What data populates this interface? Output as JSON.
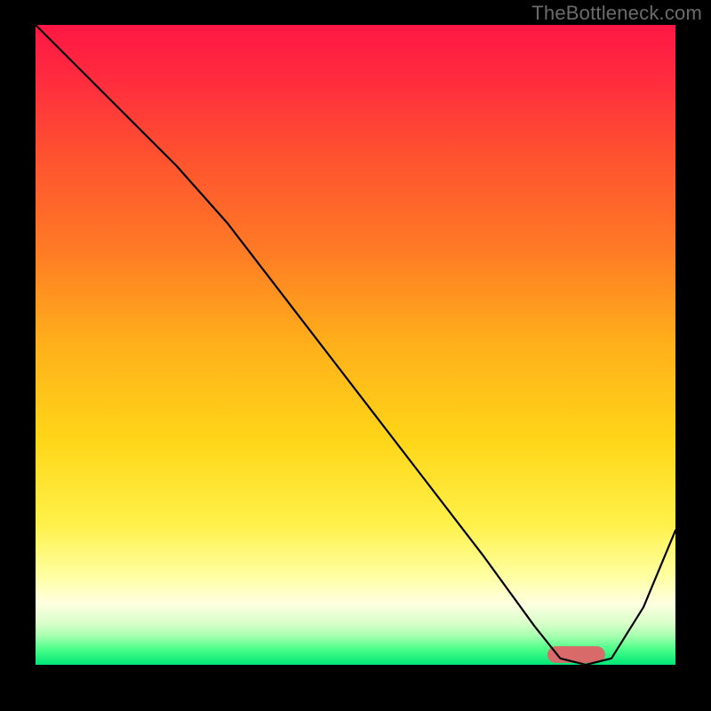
{
  "watermark": "TheBottleneck.com",
  "chart_data": {
    "type": "line",
    "title": "",
    "xlabel": "",
    "ylabel": "",
    "xlim": [
      0,
      100
    ],
    "ylim": [
      0,
      100
    ],
    "grid": false,
    "legend": false,
    "gradient_stops": [
      {
        "offset": 0.0,
        "color": "#ff1744"
      },
      {
        "offset": 0.08,
        "color": "#ff2a3f"
      },
      {
        "offset": 0.2,
        "color": "#ff5030"
      },
      {
        "offset": 0.35,
        "color": "#ff7a25"
      },
      {
        "offset": 0.5,
        "color": "#ffb01a"
      },
      {
        "offset": 0.65,
        "color": "#ffd618"
      },
      {
        "offset": 0.78,
        "color": "#fff14a"
      },
      {
        "offset": 0.86,
        "color": "#ffffa0"
      },
      {
        "offset": 0.905,
        "color": "#fdffe0"
      },
      {
        "offset": 0.935,
        "color": "#d9ffca"
      },
      {
        "offset": 0.955,
        "color": "#a6ffae"
      },
      {
        "offset": 0.975,
        "color": "#4eff8a"
      },
      {
        "offset": 1.0,
        "color": "#00e676"
      }
    ],
    "series": [
      {
        "name": "bottleneck-curve",
        "color": "#000000",
        "stroke_width": 2.2,
        "x": [
          0,
          10,
          22,
          30,
          40,
          50,
          60,
          70,
          78,
          82,
          86,
          90,
          95,
          100
        ],
        "y": [
          100,
          90,
          78,
          69,
          56,
          43,
          30,
          17,
          6,
          1,
          0,
          1,
          9,
          21
        ]
      }
    ],
    "marker": {
      "name": "optimal-marker",
      "color": "#d86a6a",
      "x_start": 80,
      "x_end": 89,
      "y": 0.3,
      "height": 2.6
    }
  }
}
